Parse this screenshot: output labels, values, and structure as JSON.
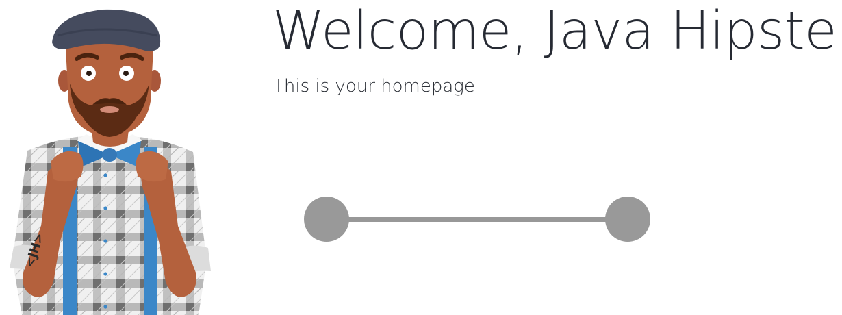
{
  "header": {
    "title": "Welcome, Java Hipster!",
    "subtitle": "This is your homepage"
  },
  "hero": {
    "icon": "hipster-illustration",
    "tattoo_text": "<JH>"
  },
  "slider": {
    "min_value": 0,
    "max_value": 1,
    "colors": {
      "track": "#989898",
      "handle": "#999999"
    }
  }
}
